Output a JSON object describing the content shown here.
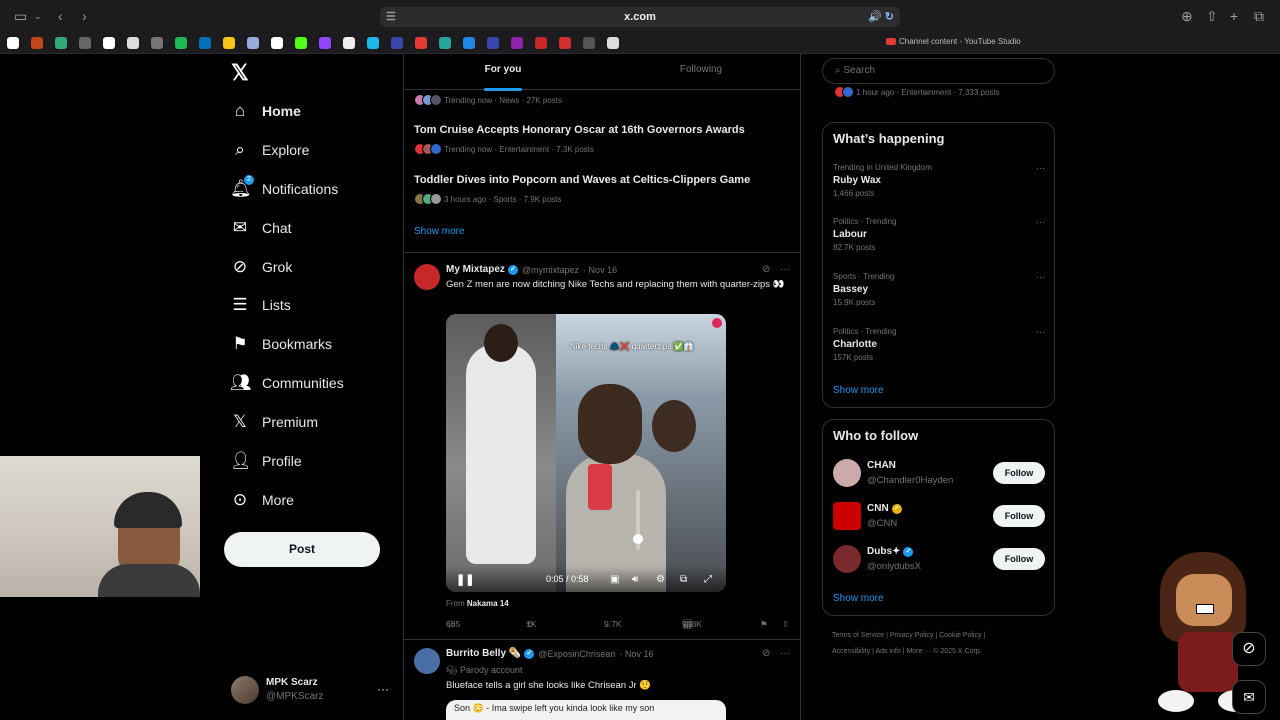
{
  "browser": {
    "url": "x.com",
    "youtube_link": "Channel content - YouTube Studio"
  },
  "nav": {
    "items": [
      {
        "label": "Home",
        "icon": "home-icon"
      },
      {
        "label": "Explore",
        "icon": "search-icon"
      },
      {
        "label": "Notifications",
        "icon": "bell-icon",
        "badge": "2"
      },
      {
        "label": "Chat",
        "icon": "mail-icon"
      },
      {
        "label": "Grok",
        "icon": "grok-icon"
      },
      {
        "label": "Lists",
        "icon": "list-icon"
      },
      {
        "label": "Bookmarks",
        "icon": "bookmark-icon"
      },
      {
        "label": "Communities",
        "icon": "communities-icon"
      },
      {
        "label": "Premium",
        "icon": "x-icon"
      },
      {
        "label": "Profile",
        "icon": "person-icon"
      },
      {
        "label": "More",
        "icon": "more-icon"
      }
    ],
    "post_label": "Post",
    "account": {
      "name": "MPK Scarz",
      "handle": "@MPKScarz"
    }
  },
  "feed": {
    "tabs": [
      "For you",
      "Following"
    ],
    "trends": [
      {
        "meta": "Trending now · News · 27K posts"
      },
      {
        "title": "Tom Cruise Accepts Honorary Oscar at 16th Governors Awards",
        "meta": "Trending now · Entertainment · 7.3K posts"
      },
      {
        "title": "Toddler Dives into Popcorn and Waves at Celtics-Clippers Game",
        "meta": "3 hours ago · Sports · 7.9K posts"
      }
    ],
    "show_more": "Show more",
    "tweet1": {
      "name": "My Mixtapez",
      "handle": "@mymixtapez",
      "date": "· Nov 16",
      "text": "Gen Z men are now ditching Nike Techs and replacing them with quarter-zips 👀",
      "video_caption": "Nike techs 🧥❌ quarterzips ✅👔",
      "video_time": "0:05 / 0:58",
      "from_label": "From",
      "from_source": "Nakama 14",
      "replies": "685",
      "reposts": "1K",
      "likes": "9.7K",
      "views": "958K"
    },
    "tweet2": {
      "name": "Burrito Belly 🌯",
      "handle": "@ExposinChrisean",
      "date": "· Nov 16",
      "parody": "Parody account",
      "text": "Blueface tells a girl she looks like Chrisean Jr 🤨",
      "video_caption": "Son 😳 - Ima swipe left you kinda look like my son"
    }
  },
  "right": {
    "search_placeholder": "Search",
    "top_meta": "1 hour ago · Entertainment · 7,333 posts",
    "happening_title": "What’s happening",
    "happening": [
      {
        "cat": "Trending in United Kingdom",
        "name": "Ruby Wax",
        "count": "1,466 posts"
      },
      {
        "cat": "Politics · Trending",
        "name": "Labour",
        "count": "82.7K posts"
      },
      {
        "cat": "Sports · Trending",
        "name": "Bassey",
        "count": "15.9K posts"
      },
      {
        "cat": "Politics · Trending",
        "name": "Charlotte",
        "count": "157K posts"
      }
    ],
    "show_more": "Show more",
    "wtf_title": "Who to follow",
    "wtf": [
      {
        "name": "CHAN",
        "handle": "@Chandler0Hayden",
        "follow": "Follow"
      },
      {
        "name": "CNN",
        "handle": "@CNN",
        "follow": "Follow"
      },
      {
        "name": "Dubs✦",
        "handle": "@onlydubsX",
        "follow": "Follow"
      }
    ],
    "footer1": "Terms of Service  |  Privacy Policy  |  Cookie Policy  |",
    "footer2": "Accessibility  |  Ads info  |  More ···  © 2025 X Corp."
  }
}
